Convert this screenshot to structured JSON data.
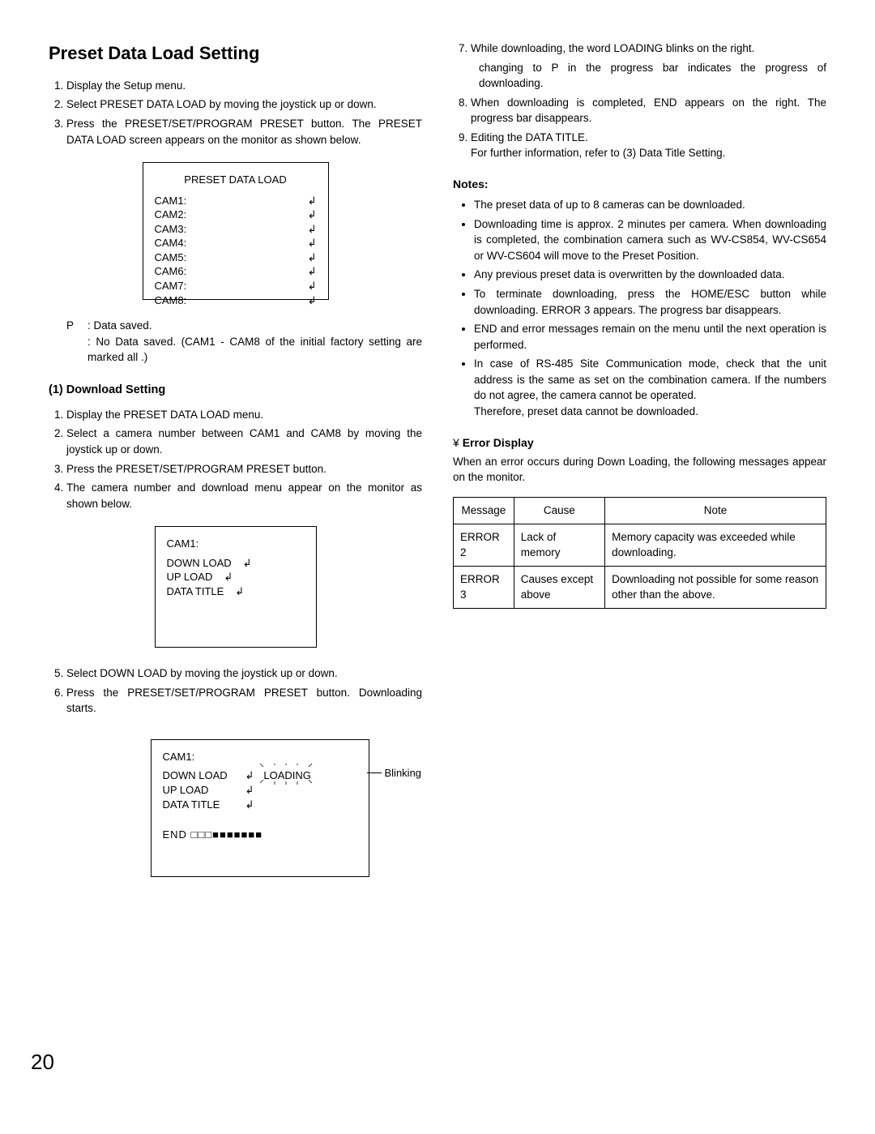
{
  "title": "Preset Data Load Setting",
  "intro_steps": [
    "Display the Setup menu.",
    "Select PRESET DATA LOAD by moving the joystick up or down.",
    "Press the PRESET/SET/PROGRAM PRESET button. The PRESET DATA LOAD screen appears on the monitor as shown below."
  ],
  "screen1_title": "PRESET DATA LOAD",
  "screen1_rows": [
    [
      "CAM1:",
      "↲"
    ],
    [
      "CAM2:",
      "↲"
    ],
    [
      "CAM3:",
      "↲"
    ],
    [
      "CAM4:",
      "↲"
    ],
    [
      "CAM5:",
      "↲"
    ],
    [
      "CAM6:",
      "↲"
    ],
    [
      "CAM7:",
      "↲"
    ],
    [
      "CAM8:",
      "↲"
    ]
  ],
  "legend": [
    [
      "P",
      ": Data saved."
    ],
    [
      "",
      ": No Data saved. (CAM1 - CAM8 of the initial factory setting are marked all  .)"
    ]
  ],
  "download_heading": "(1) Download Setting",
  "download_steps": [
    "Display the PRESET DATA LOAD menu.",
    "Select a camera number between CAM1 and CAM8 by moving the joystick up or down.",
    "Press the PRESET/SET/PROGRAM PRESET button.",
    "The camera number and download menu appear on the monitor as shown below."
  ],
  "screen2_title": "CAM1:",
  "screen2_rows": [
    [
      "DOWN LOAD",
      "↲"
    ],
    [
      "UP  LOAD",
      "↲"
    ],
    [
      "DATA TITLE",
      "↲"
    ]
  ],
  "steps56": [
    "Select DOWN LOAD by moving the joystick up or down.",
    "Press the PRESET/SET/PROGRAM PRESET button. Downloading starts."
  ],
  "screen3_title": "CAM1:",
  "screen3_rows": [
    [
      "DOWN LOAD",
      "↲",
      "LOADING"
    ],
    [
      "UP  LOAD",
      "↲",
      ""
    ],
    [
      "DATA TITLE",
      "↲",
      ""
    ]
  ],
  "screen3_progress": "END    □□□■■■■■■■",
  "blinking_label": "Blinking",
  "right_steps": [
    "While downloading, the word LOADING blinks on the right.",
    "When downloading is completed, END appears on the right. The progress bar disappears.",
    "Editing the DATA TITLE."
  ],
  "right_sub_line": "changing to  P  in the progress bar indicates the progress of downloading.",
  "right_sub_line2": "For further information, refer to (3) Data Title Setting.",
  "notes_title": "Notes:",
  "notes": [
    "The preset data of up to 8 cameras can be downloaded.",
    "Downloading time is approx. 2 minutes per camera. When downloading is completed, the combination camera such as WV-CS854, WV-CS654 or WV-CS604 will move to the Preset Position.",
    "Any previous preset data is overwritten by the downloaded data.",
    "To terminate downloading, press the HOME/ESC button while downloading. ERROR 3 appears. The progress bar disappears.",
    "END and error messages remain on the menu until the next operation is performed.",
    "In case of RS-485 Site Communication mode, check that the unit address is the same as set on the combination camera. If the numbers do not agree, the camera cannot be operated."
  ],
  "notes_tail": "Therefore, preset data cannot be downloaded.",
  "error_heading": "¥ Error Display",
  "error_intro": "When an error occurs during Down Loading, the following messages appear on the monitor.",
  "error_headers": [
    "Message",
    "Cause",
    "Note"
  ],
  "error_rows": [
    [
      "ERROR 2",
      "Lack of memory",
      "Memory capacity was exceeded while downloading."
    ],
    [
      "ERROR 3",
      "Causes except above",
      "Downloading not possible for some reason other than the above."
    ]
  ],
  "page_number": "20"
}
